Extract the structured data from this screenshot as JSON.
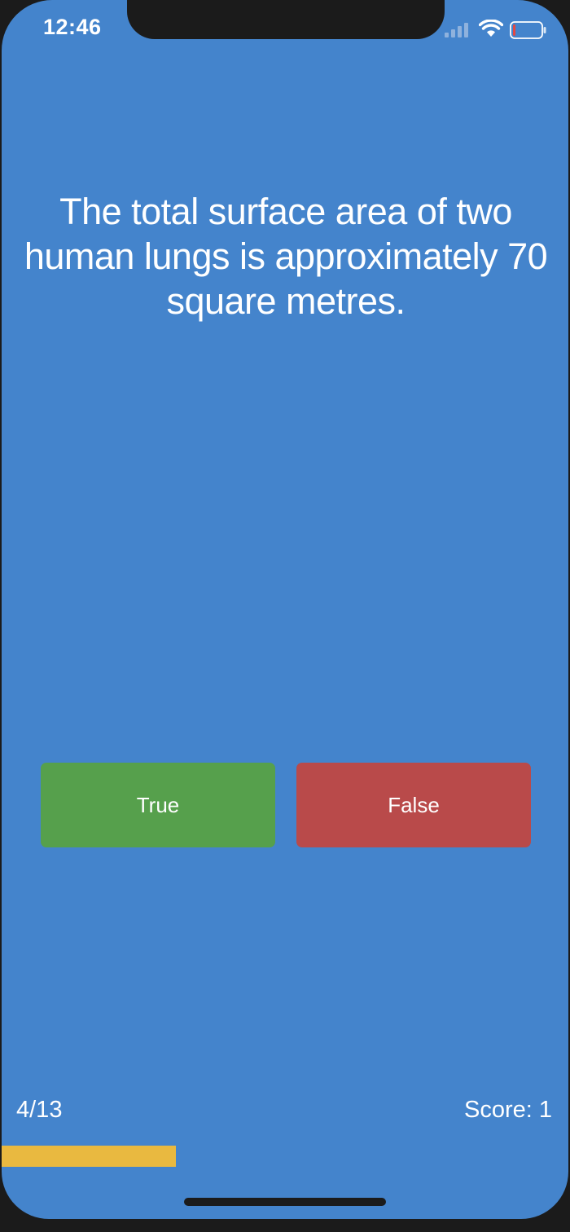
{
  "status_bar": {
    "time": "12:46",
    "icons": [
      "cellular-signal-icon",
      "wifi-icon",
      "battery-low-icon"
    ],
    "battery_level": 0.1
  },
  "quiz": {
    "question": "The total surface area of two human lungs is approximately 70 square metres.",
    "true_label": "True",
    "false_label": "False",
    "progress_text": "4/13",
    "score_text": "Score: 1",
    "progress_fraction": 0.3077
  },
  "colors": {
    "background": "#4484cc",
    "true_button": "#56a04c",
    "false_button": "#b94a4a",
    "progress_bar": "#e9b940"
  }
}
